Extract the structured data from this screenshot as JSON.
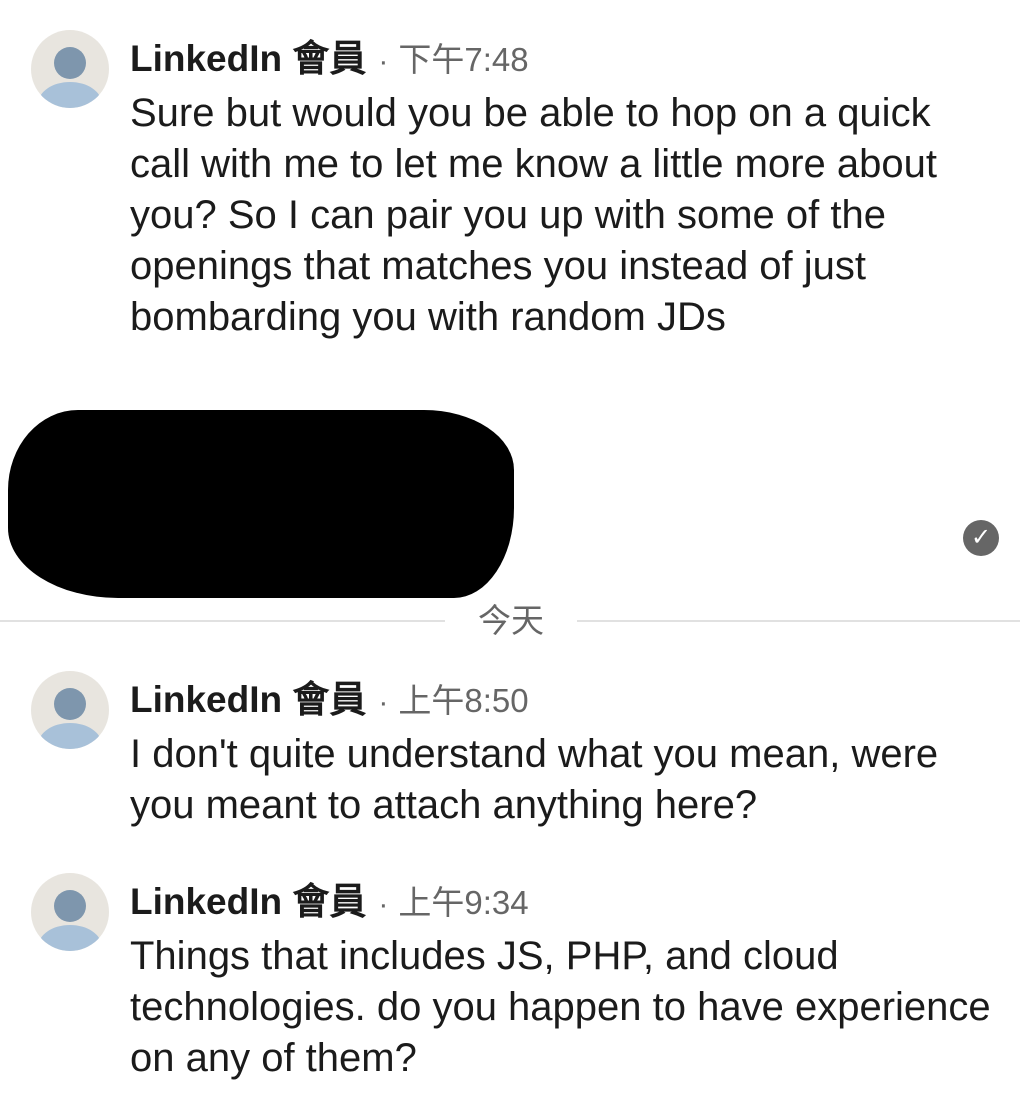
{
  "messages": [
    {
      "sender": "LinkedIn 會員",
      "separator": "·",
      "time": "下午7:48",
      "text": "Sure but would you be able to hop on a quick call with me to let me know a little more about you? So I can pair you up with some of the openings that matches you instead of just bombarding you with random JDs"
    },
    {
      "sender": "LinkedIn 會員",
      "separator": "·",
      "time": "上午8:50",
      "text": "I don't quite understand what you mean, were you meant to attach anything here?"
    },
    {
      "sender": "LinkedIn 會員",
      "separator": "·",
      "time": "上午9:34",
      "text": "Things that includes JS, PHP, and cloud technologies. do you happen to have experience on any of them?"
    }
  ],
  "date_divider": "今天",
  "read_receipt_icon": "check-circle-icon",
  "colors": {
    "text": "#1b1b1b",
    "meta": "#666666",
    "divider": "#e1e1e1",
    "avatar_bg": "#e8e5df",
    "avatar_head": "#7e96ad",
    "avatar_body": "#a8c1d9"
  }
}
